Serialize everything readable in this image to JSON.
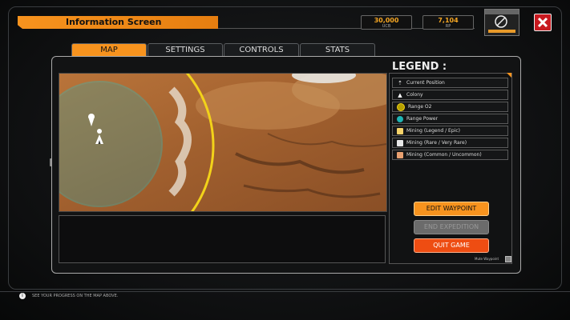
{
  "header": {
    "title": "Information Screen"
  },
  "resources": [
    {
      "value": "30,000",
      "label": "UCB"
    },
    {
      "value": "7,104",
      "label": "RP"
    }
  ],
  "tabs": [
    {
      "label": "MAP",
      "active": true
    },
    {
      "label": "SETTINGS",
      "active": false
    },
    {
      "label": "CONTROLS",
      "active": false
    },
    {
      "label": "STATS",
      "active": false
    }
  ],
  "legend": {
    "title": "LEGEND :",
    "items": [
      {
        "label": "Current Position",
        "icon": "position-marker-icon",
        "color": "#ffffff"
      },
      {
        "label": "Colony",
        "icon": "colony-icon",
        "color": "#ffffff"
      },
      {
        "label": "Range O2",
        "icon": "range-o2-icon",
        "color": "#c8b400"
      },
      {
        "label": "Range Power",
        "icon": "range-power-icon",
        "color": "#1fb5b5"
      },
      {
        "label": "Mining (Legend / Epic)",
        "icon": "mining-legend-icon",
        "color": "#f5d36a"
      },
      {
        "label": "Mining (Rare / Very Rare)",
        "icon": "mining-rare-icon",
        "color": "#e8e8e8"
      },
      {
        "label": "Mining (Common / Uncommon)",
        "icon": "mining-common-icon",
        "color": "#e8a070"
      }
    ]
  },
  "buttons": {
    "edit_waypoint": "EDIT WAYPOINT",
    "end_expedition": "END EXPEDITION",
    "quit_game": "QUIT GAME"
  },
  "mute_label": "Mute Waypoint",
  "footer": {
    "hint": "SEE YOUR PROGRESS ON THE MAP ABOVE."
  },
  "colors": {
    "accent": "#f7931e",
    "danger": "#c8191f",
    "o2_range": "#f2d21a",
    "power_range": "#27c3c8"
  }
}
